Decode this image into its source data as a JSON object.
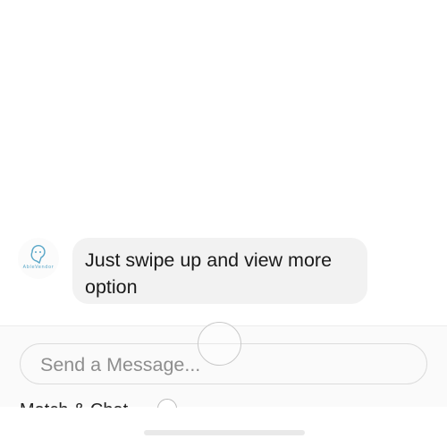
{
  "chat": {
    "messages": [
      {
        "sender": "bot",
        "avatar_text": "AbleVendor",
        "text": "Just swipe up and view more option"
      }
    ]
  },
  "composer": {
    "placeholder": "Send a Message...",
    "value": ""
  },
  "options_row": {
    "label": "Match & Chat",
    "toggle_state": "off"
  },
  "icons": {
    "avatar": "chat-bot-logo-icon",
    "toggle": "radio-toggle-icon"
  },
  "colors": {
    "bubble_bg": "#f2f2f2",
    "logo_accent": "#5aa7c8",
    "placeholder": "#8e8e8e"
  }
}
